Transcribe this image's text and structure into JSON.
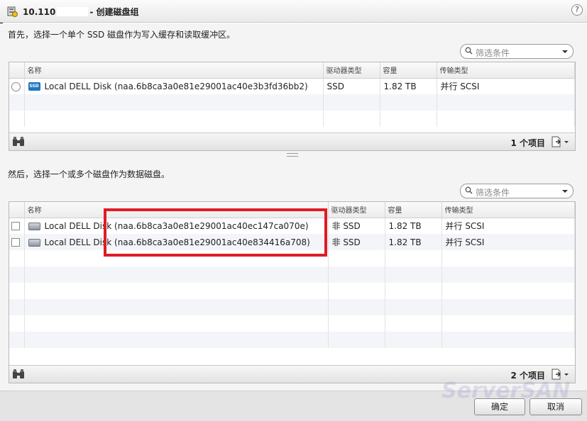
{
  "window": {
    "title_prefix": "10.110",
    "title_suffix": "- 创建磁盘组",
    "help": "?"
  },
  "cache_section": {
    "instruction": "首先，选择一个单个 SSD 磁盘作为写入缓存和读取缓冲区。",
    "filter_placeholder": "筛选条件",
    "columns": [
      "名称",
      "驱动器类型",
      "容量",
      "传输类型"
    ],
    "rows": [
      {
        "name": "Local DELL Disk (naa.6b8ca3a0e81e29001ac40e3b3fd36bb2)",
        "drive_type": "SSD",
        "capacity": "1.82 TB",
        "transport": "并行 SCSI",
        "icon": "ssd-icon"
      }
    ],
    "item_count": "1 个项目"
  },
  "data_section": {
    "instruction": "然后，选择一个或多个磁盘作为数据磁盘。",
    "filter_placeholder": "筛选条件",
    "columns": [
      "名称",
      "驱动器类型",
      "容量",
      "传输类型"
    ],
    "rows": [
      {
        "name": "Local DELL Disk (naa.6b8ca3a0e81e29001ac40ec147ca070e)",
        "drive_type": "非 SSD",
        "capacity": "1.82 TB",
        "transport": "并行 SCSI",
        "icon": "hdd-icon"
      },
      {
        "name": "Local DELL Disk (naa.6b8ca3a0e81e29001ac40e834416a708)",
        "drive_type": "非 SSD",
        "capacity": "1.82 TB",
        "transport": "并行 SCSI",
        "icon": "hdd-icon"
      }
    ],
    "item_count": "2 个项目"
  },
  "buttons": {
    "ok": "确定",
    "cancel": "取消"
  },
  "watermark": "ServerSAN",
  "colors": {
    "highlight": "#e01b24",
    "ssd_icon": "#1e78c2"
  }
}
